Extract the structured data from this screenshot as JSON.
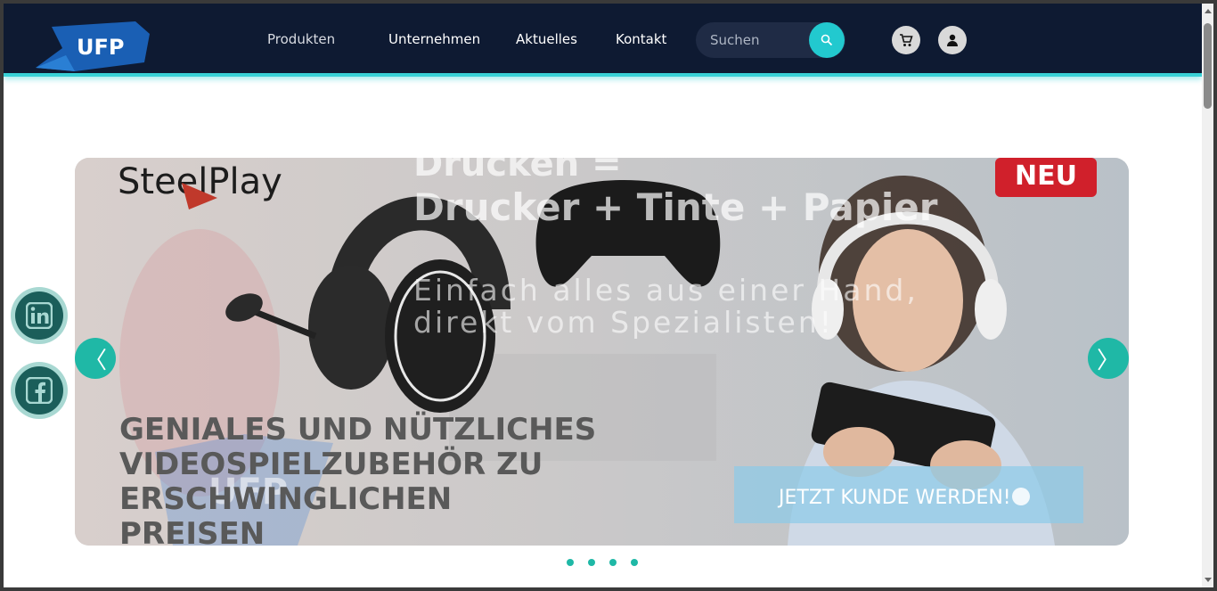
{
  "brand": {
    "logo_text": "UFP"
  },
  "nav": {
    "items": [
      {
        "label": "Produkten"
      },
      {
        "label": "Unternehmen"
      },
      {
        "label": "Aktuelles"
      },
      {
        "label": "Kontakt"
      }
    ],
    "search": {
      "placeholder": "Suchen"
    },
    "icons": {
      "search": "search-icon",
      "cart": "cart-icon",
      "account": "user-icon"
    }
  },
  "slide": {
    "brand": "SteelPlay",
    "badge": "NEU",
    "headline_back": [
      "Drucken =",
      "Drucker + Tinte + Papier"
    ],
    "subline_back": [
      "Einfach alles aus einer Hand,",
      "direkt vom Spezialisten!"
    ],
    "headline_front": [
      "GENIALES UND NÜTZLICHES",
      "VIDEOSPIELZUBEHÖR ZU",
      "ERSCHWINGLICHEN",
      "PREISEN"
    ],
    "cta": "JETZT KUNDE WERDEN!",
    "watermark_logo": "UFP"
  },
  "carousel": {
    "prev": "〈",
    "next": "〉",
    "dots": 4
  },
  "social": [
    {
      "name": "linkedin",
      "icon": "linkedin-icon"
    },
    {
      "name": "facebook",
      "icon": "facebook-icon"
    }
  ],
  "colors": {
    "nav_bg": "#0e1a32",
    "accent": "#22c9cf",
    "arrow": "#1fb8a6",
    "social": "#1b5e5a"
  }
}
